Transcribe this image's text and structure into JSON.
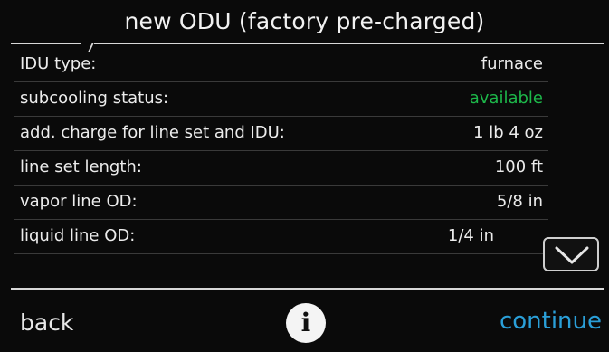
{
  "header": {
    "title": "new ODU (factory pre-charged)"
  },
  "rows": [
    {
      "label": "IDU type:",
      "value": "furnace",
      "value_color": "#ececec"
    },
    {
      "label": "subcooling status:",
      "value": "available",
      "value_color": "#1db84a"
    },
    {
      "label": "add. charge for line set and IDU:",
      "value": "1 lb 4 oz",
      "value_color": "#ececec"
    },
    {
      "label": "line set length:",
      "value": "100 ft",
      "value_color": "#ececec"
    },
    {
      "label": "vapor line OD:",
      "value": "5/8 in",
      "value_color": "#ececec"
    },
    {
      "label": "liquid line OD:",
      "value": "1/4 in",
      "value_color": "#ececec"
    }
  ],
  "scroll": {
    "icon": "chevron-down-icon"
  },
  "footer": {
    "back_label": "back",
    "info_icon_text": "i",
    "continue_label": "continue",
    "continue_color": "#2a9fd8"
  }
}
